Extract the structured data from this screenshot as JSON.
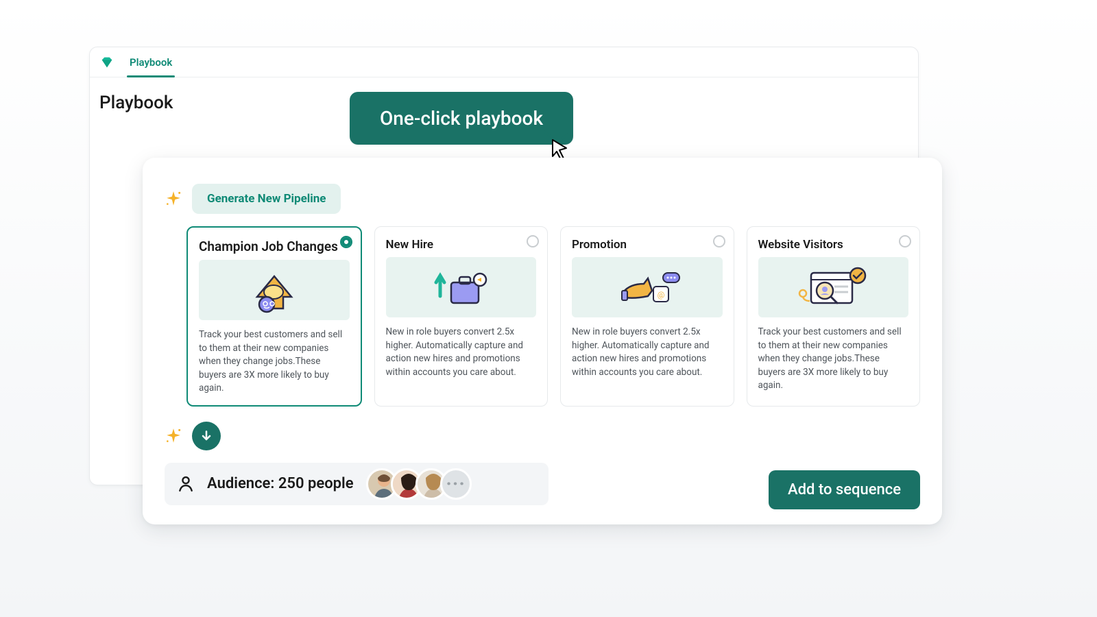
{
  "header": {
    "tab_label": "Playbook",
    "page_title": "Playbook",
    "one_click_label": "One-click playbook"
  },
  "generator": {
    "label": "Generate New Pipeline"
  },
  "pipeline_cards": [
    {
      "title": "Champion Job Changes",
      "selected": true,
      "description": "Track your best customers and sell to them at their new companies when they change jobs.These buyers are 3X more likely to buy again."
    },
    {
      "title": "New Hire",
      "selected": false,
      "description": "New in role buyers convert 2.5x higher. Automatically capture and action new hires and promotions within accounts you care about."
    },
    {
      "title": "Promotion",
      "selected": false,
      "description": "New in role buyers convert 2.5x higher. Automatically capture and action new hires and promotions within accounts you care about."
    },
    {
      "title": "Website Visitors",
      "selected": false,
      "description": "Track your best customers and sell to them at their new companies when they change jobs.These buyers are 3X more likely to buy again."
    }
  ],
  "audience": {
    "label": "Audience: 250 people",
    "more_label": "···"
  },
  "actions": {
    "add_to_sequence": "Add to sequence"
  },
  "colors": {
    "brand_teal": "#1a7266",
    "brand_teal_text": "#0f8a76",
    "pill_bg": "#e3f1ee",
    "card_bg": "#e8f3f0"
  }
}
